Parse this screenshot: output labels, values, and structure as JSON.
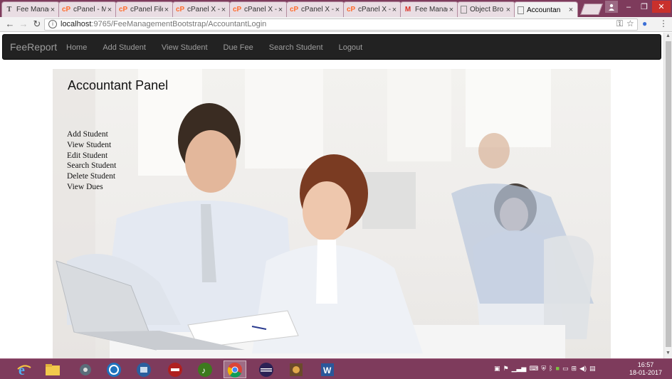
{
  "browser": {
    "tabs": [
      {
        "label": "Fee Manag",
        "icon": "text-page-icon"
      },
      {
        "label": "cPanel - M",
        "icon": "cpanel-icon"
      },
      {
        "label": "cPanel File",
        "icon": "cpanel-icon"
      },
      {
        "label": "cPanel X -",
        "icon": "cpanel-icon"
      },
      {
        "label": "cPanel X -",
        "icon": "cpanel-icon"
      },
      {
        "label": "cPanel X -",
        "icon": "cpanel-icon"
      },
      {
        "label": "cPanel X -",
        "icon": "cpanel-icon"
      },
      {
        "label": "Fee Manag",
        "icon": "gmail-icon"
      },
      {
        "label": "Object Bro",
        "icon": "page-icon"
      },
      {
        "label": "Accountan",
        "icon": "page-icon",
        "active": true
      }
    ],
    "url_host": "localhost",
    "url_path": ":9765/FeeManagementBootstrap/AccountantLogin"
  },
  "navbar": {
    "brand": "FeeReport",
    "links": [
      "Home",
      "Add Student",
      "View Student",
      "Due Fee",
      "Search Student",
      "Logout"
    ]
  },
  "main": {
    "title": "Accountant Panel",
    "menu": [
      "Add Student",
      "View Student",
      "Edit Student",
      "Search Student",
      "Delete Student",
      "View Dues"
    ]
  },
  "taskbar": {
    "time": "16:57",
    "date": "18-01-2017"
  },
  "colors": {
    "taskbar": "#7e3b5c",
    "navbar": "#222222",
    "nav_text": "#9d9d9d"
  }
}
